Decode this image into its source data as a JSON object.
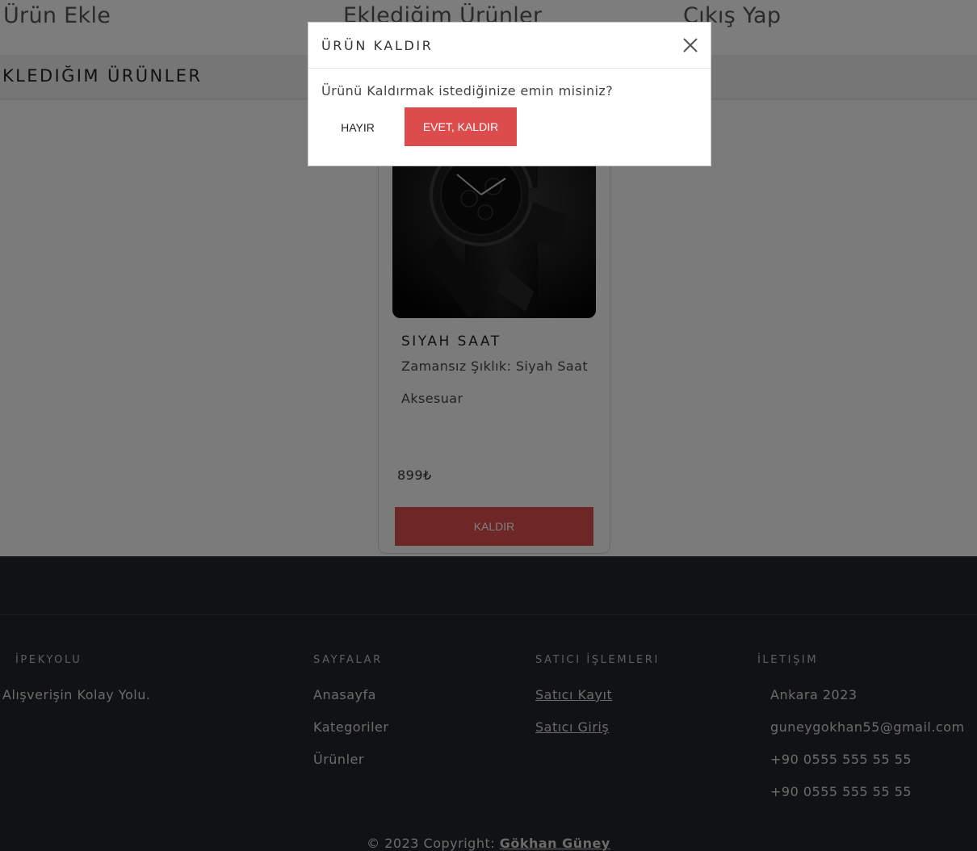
{
  "nav": {
    "items": [
      {
        "label": "Ürün Ekle"
      },
      {
        "label": "Eklediğim Ürünler"
      },
      {
        "label": "Çıkış Yap"
      }
    ]
  },
  "section": {
    "title": "KLEDIĞIM ÜRÜNLER"
  },
  "product": {
    "name": "SIYAH SAAT",
    "description": "Zamansız Şıklık: Siyah Saat",
    "category": "Aksesuar",
    "price": "899₺",
    "remove_label": "KALDIR",
    "image_icon": "watch-image"
  },
  "modal": {
    "title": "ÜRÜN KALDIR",
    "message": "Ürünü Kaldırmak istediğinize emin misiniz?",
    "no_label": "HAYIR",
    "yes_label": "EVET, KALDIR",
    "close_icon": "close-icon"
  },
  "footer": {
    "brand": {
      "heading": "İPEKYOLU",
      "tagline": "Alışverişin Kolay Yolu."
    },
    "pages": {
      "heading": "SAYFALAR",
      "links": [
        "Anasayfa",
        "Kategoriler",
        "Ürünler"
      ]
    },
    "seller": {
      "heading": "SATICI İŞLEMLERI",
      "links": [
        "Satıcı Kayıt",
        "Satıcı Giriş"
      ]
    },
    "contact": {
      "heading": "İLETIŞIM",
      "lines": [
        "Ankara 2023",
        "guneygokhan55@gmail.com",
        "+90 0555 555 55 55",
        "+90 0555 555 55 55"
      ]
    },
    "copyright_prefix": "© 2023 Copyright:",
    "copyright_name": "Gökhan Güney"
  },
  "colors": {
    "accent_red": "#dc4c4c",
    "footer_bg": "#212529",
    "overlay": "rgba(0,0,0,0.5)"
  }
}
